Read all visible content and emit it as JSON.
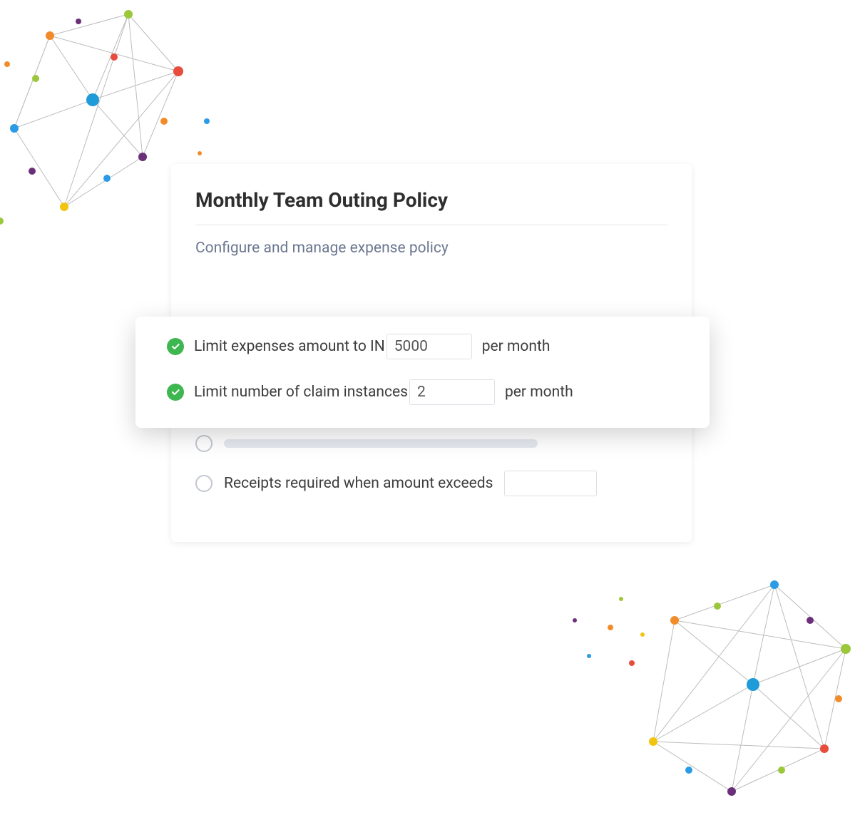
{
  "policy": {
    "title": "Monthly Team Outing Policy",
    "subtitle": "Configure and manage expense policy"
  },
  "rules": {
    "limit_amount": {
      "prefix": "Limit expenses amount to IN",
      "value": "5000",
      "suffix": "per month"
    },
    "limit_instances": {
      "prefix": "Limit number of claim instances",
      "value": "2",
      "suffix": "per month"
    }
  },
  "options": {
    "receipts": {
      "label": "Receipts required when amount exceeds",
      "value": ""
    }
  }
}
